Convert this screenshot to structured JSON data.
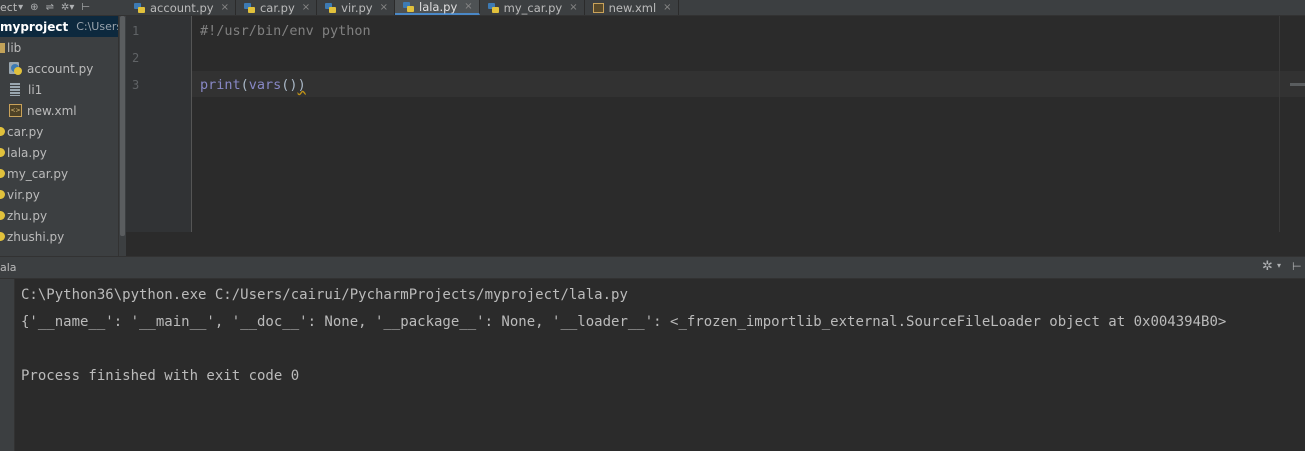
{
  "toolbar": {
    "view_label": "ect",
    "icons": [
      "dropdown-caret-icon",
      "sync-icon",
      "collapse-all-icon",
      "gear-icon",
      "hide-panel-icon"
    ]
  },
  "tabs": [
    {
      "label": "account.py",
      "icon": "python-file-icon",
      "active": false
    },
    {
      "label": "car.py",
      "icon": "python-file-icon",
      "active": false
    },
    {
      "label": "vir.py",
      "icon": "python-file-icon",
      "active": false
    },
    {
      "label": "lala.py",
      "icon": "python-file-icon",
      "active": true
    },
    {
      "label": "my_car.py",
      "icon": "python-file-icon",
      "active": false
    },
    {
      "label": "new.xml",
      "icon": "xml-file-icon",
      "active": false
    }
  ],
  "tab_close_glyph": "×",
  "project": {
    "name": "myproject",
    "path": "C:\\Users\\cai",
    "tree": [
      {
        "label": "lib",
        "type": "folder"
      },
      {
        "label": "account.py",
        "type": "py"
      },
      {
        "label": "li1",
        "type": "text"
      },
      {
        "label": "new.xml",
        "type": "xml"
      },
      {
        "label": "car.py",
        "type": "py-small"
      },
      {
        "label": "lala.py",
        "type": "py-small"
      },
      {
        "label": "my_car.py",
        "type": "py-small"
      },
      {
        "label": "vir.py",
        "type": "py-small"
      },
      {
        "label": "zhu.py",
        "type": "py-small"
      },
      {
        "label": "zhushi.py",
        "type": "py-small"
      }
    ]
  },
  "editor": {
    "line_numbers": [
      "1",
      "2",
      "3"
    ],
    "line1": "#!/usr/bin/env python",
    "line3": {
      "fn": "print",
      "open1": "(",
      "inner": "vars",
      "parens": "()",
      "close1": ")"
    }
  },
  "run": {
    "title": "ala",
    "console": [
      "C:\\Python36\\python.exe C:/Users/cairui/PycharmProjects/myproject/lala.py",
      "{'__name__': '__main__', '__doc__': None, '__package__': None, '__loader__': <_frozen_importlib_external.SourceFileLoader object at 0x004394B0>",
      "",
      "Process finished with exit code 0"
    ]
  }
}
